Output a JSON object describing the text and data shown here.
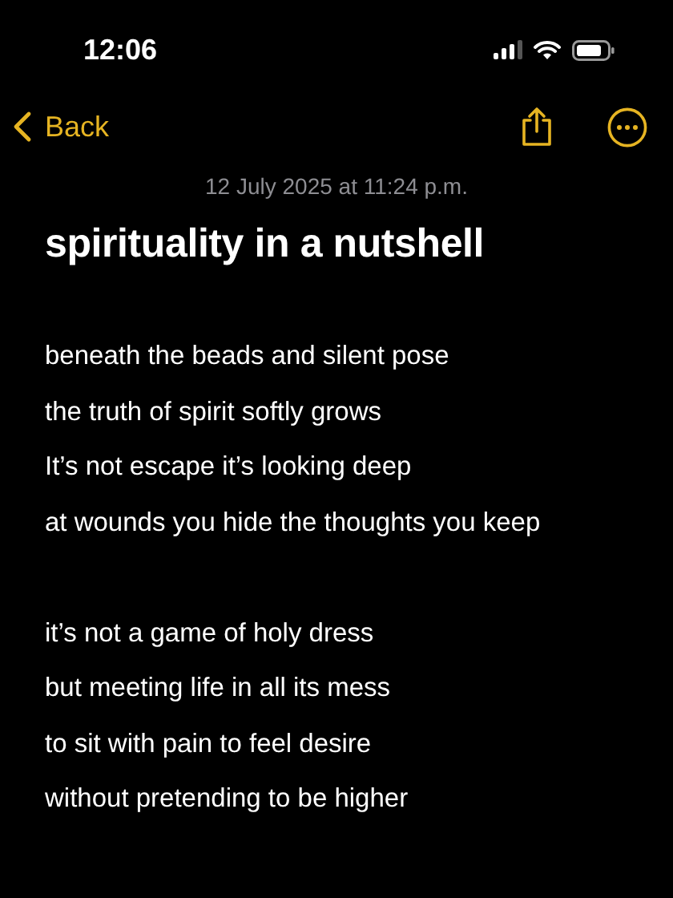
{
  "status_bar": {
    "time": "12:06"
  },
  "nav": {
    "back_label": "Back"
  },
  "note": {
    "date": "12 July 2025 at 11:24 p.m.",
    "title": "spirituality in a nutshell",
    "stanzas": [
      [
        "beneath the beads and silent pose",
        "the truth of spirit softly grows",
        "It’s not escape it’s looking deep",
        "at wounds you hide the thoughts you keep"
      ],
      [
        "it’s not a game of holy dress",
        "but meeting life in all its mess",
        "to sit with pain to feel desire",
        "without pretending to be higher"
      ]
    ]
  }
}
